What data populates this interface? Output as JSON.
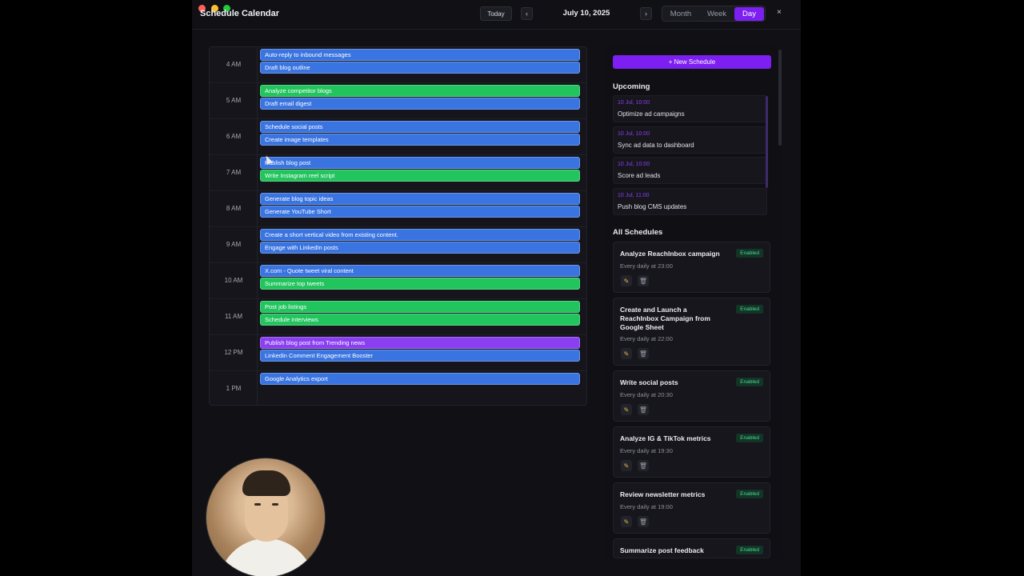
{
  "app": {
    "title": "Schedule Calendar",
    "accent": "#7c1ff0"
  },
  "toolbar": {
    "today_label": "Today",
    "prev_label": "‹",
    "next_label": "›",
    "date": "July 10, 2025",
    "views": [
      "Month",
      "Week",
      "Day"
    ],
    "active_view": "Day",
    "close_label": "×"
  },
  "calendar": {
    "hours": [
      "4 AM",
      "5 AM",
      "6 AM",
      "7 AM",
      "8 AM",
      "9 AM",
      "10 AM",
      "11 AM",
      "12 PM",
      "1 PM"
    ],
    "events": [
      {
        "title": "Auto-reply to inbound messages",
        "color": "blue"
      },
      {
        "title": "Draft blog outline",
        "color": "blue"
      },
      {
        "title": "Analyze competitor blogs",
        "color": "green"
      },
      {
        "title": "Draft email digest",
        "color": "blue"
      },
      {
        "title": "Schedule social posts",
        "color": "blue"
      },
      {
        "title": "Create image templates",
        "color": "blue"
      },
      {
        "title": "Publish blog post",
        "color": "blue"
      },
      {
        "title": "Write Instagram reel script",
        "color": "green"
      },
      {
        "title": "Generate blog topic ideas",
        "color": "blue"
      },
      {
        "title": "Generate YouTube Short",
        "color": "blue"
      },
      {
        "title": "Create a short vertical video from existing content.",
        "color": "blue"
      },
      {
        "title": "Engage with LinkedIn posts",
        "color": "blue"
      },
      {
        "title": "X.com - Quote tweet viral content",
        "color": "blue"
      },
      {
        "title": "Summarize top tweets",
        "color": "green"
      },
      {
        "title": "Post job listings",
        "color": "green"
      },
      {
        "title": "Schedule interviews",
        "color": "green"
      },
      {
        "title": "Publish blog post from Trending news",
        "color": "purple"
      },
      {
        "title": "Linkedin Comment Engagement Booster",
        "color": "blue"
      },
      {
        "title": "Google Analytics export",
        "color": "blue"
      }
    ]
  },
  "sidebar": {
    "new_button": "+ New Schedule",
    "upcoming_title": "Upcoming",
    "upcoming": [
      {
        "time": "10 Jul, 10:00",
        "title": "Optimize ad campaigns"
      },
      {
        "time": "10 Jul, 10:00",
        "title": "Sync ad data to dashboard"
      },
      {
        "time": "10 Jul, 10:00",
        "title": "Score ad leads"
      },
      {
        "time": "10 Jul, 11:00",
        "title": "Push blog CMS updates"
      }
    ],
    "all_title": "All Schedules",
    "schedules": [
      {
        "name": "Analyze ReachInbox campaign",
        "status": "Enabled",
        "freq": "Every daily at 23:00"
      },
      {
        "name": "Create and Launch a ReachInbox Campaign from Google Sheet",
        "status": "Enabled",
        "freq": "Every daily at 22:00"
      },
      {
        "name": "Write social posts",
        "status": "Enabled",
        "freq": "Every daily at 20:30"
      },
      {
        "name": "Analyze IG & TikTok metrics",
        "status": "Enabled",
        "freq": "Every daily at 19:30"
      },
      {
        "name": "Review newsletter metrics",
        "status": "Enabled",
        "freq": "Every daily at 19:00"
      },
      {
        "name": "Summarize post feedback",
        "status": "Enabled",
        "freq": ""
      }
    ]
  }
}
